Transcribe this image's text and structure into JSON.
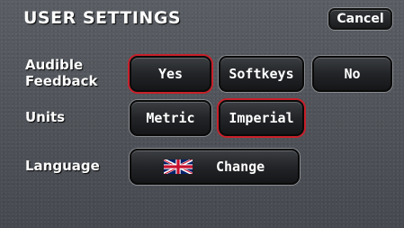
{
  "header": {
    "title": "USER SETTINGS",
    "cancel_label": "Cancel"
  },
  "settings": {
    "audible_feedback": {
      "label": "Audible\nFeedback",
      "options": [
        "Yes",
        "Softkeys",
        "No"
      ],
      "selected": "Yes"
    },
    "units": {
      "label": "Units",
      "options": [
        "Metric",
        "Imperial"
      ],
      "selected": "Imperial"
    },
    "language": {
      "label": "Language",
      "flag_icon": "uk-flag-icon",
      "change_label": "Change"
    }
  },
  "colors": {
    "selected_border": "#c8202a",
    "text": "#ffffff"
  }
}
